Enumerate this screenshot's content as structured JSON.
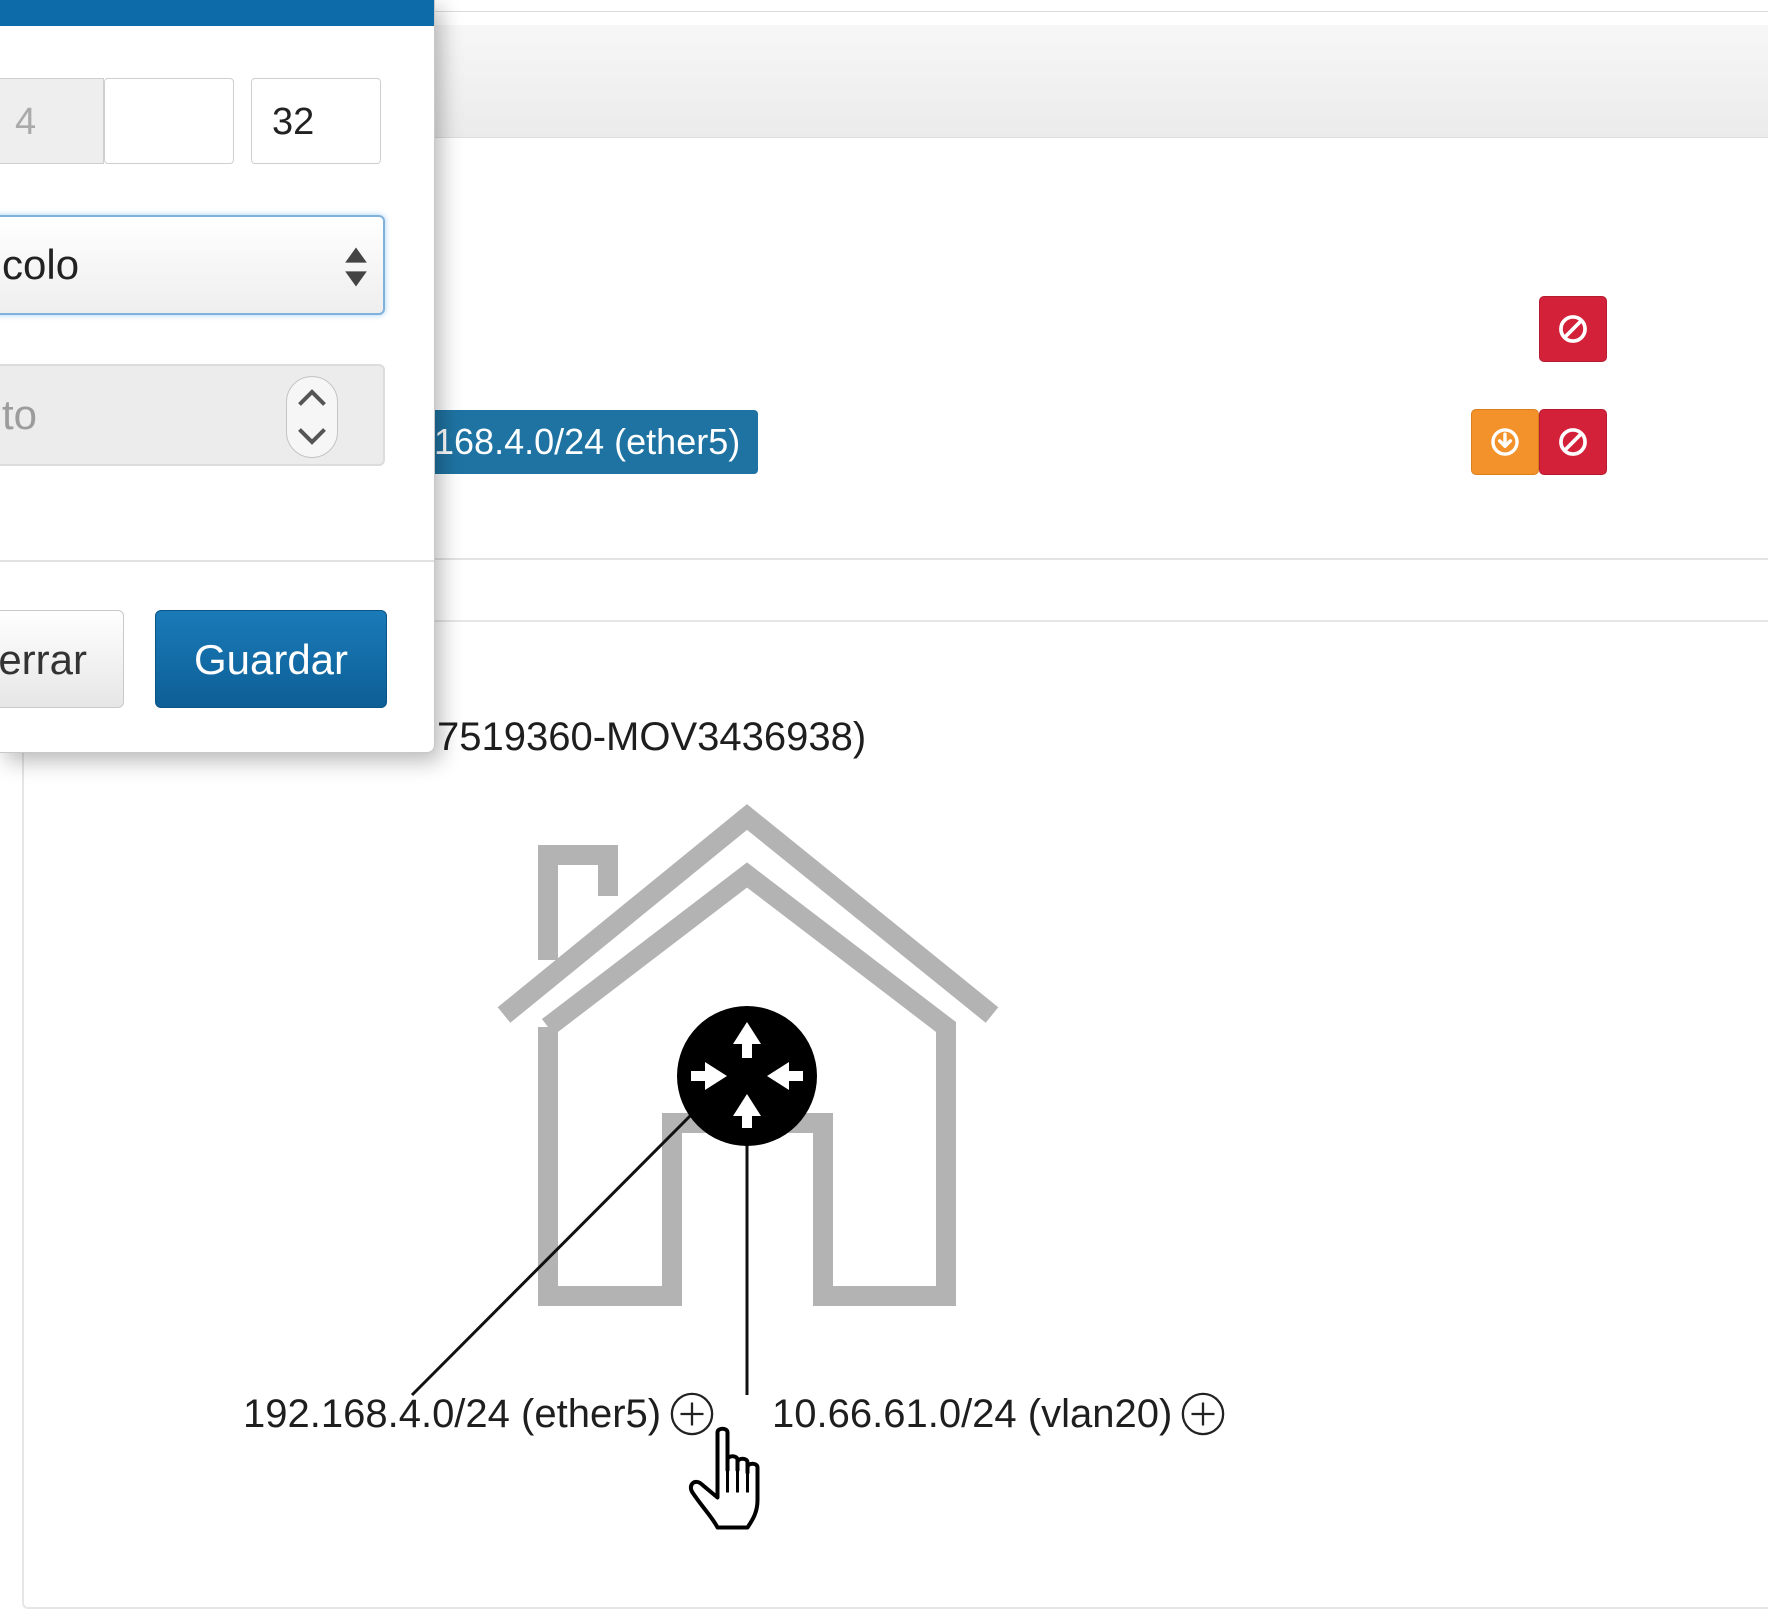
{
  "modal": {
    "segment_1": "4",
    "segment_2": "",
    "segment_3": "32",
    "select_value": "colo",
    "spinner_value": "to",
    "close_label": "errar",
    "save_label": "Guardar"
  },
  "rows": {
    "network_label": "168.4.0/24 (ether5)"
  },
  "diagram": {
    "router_title": "7519360-MOV3436938)",
    "interfaces": [
      {
        "label": "192.168.4.0/24 (ether5)"
      },
      {
        "label": "10.66.61.0/24 (vlan20)"
      }
    ],
    "icons": {
      "house": "house-icon",
      "router": "router-icon",
      "add": "plus-circle-icon",
      "cursor": "hand-pointer-icon",
      "ban": "ban-icon",
      "download": "download-icon"
    }
  },
  "colors": {
    "modal_header": "#0c6ba8",
    "primary_button": "#0d5f96",
    "network_label_bg": "#1f73a2",
    "danger": "#d4213a",
    "warning": "#f3922b",
    "house_stroke": "#b3b3b3"
  }
}
